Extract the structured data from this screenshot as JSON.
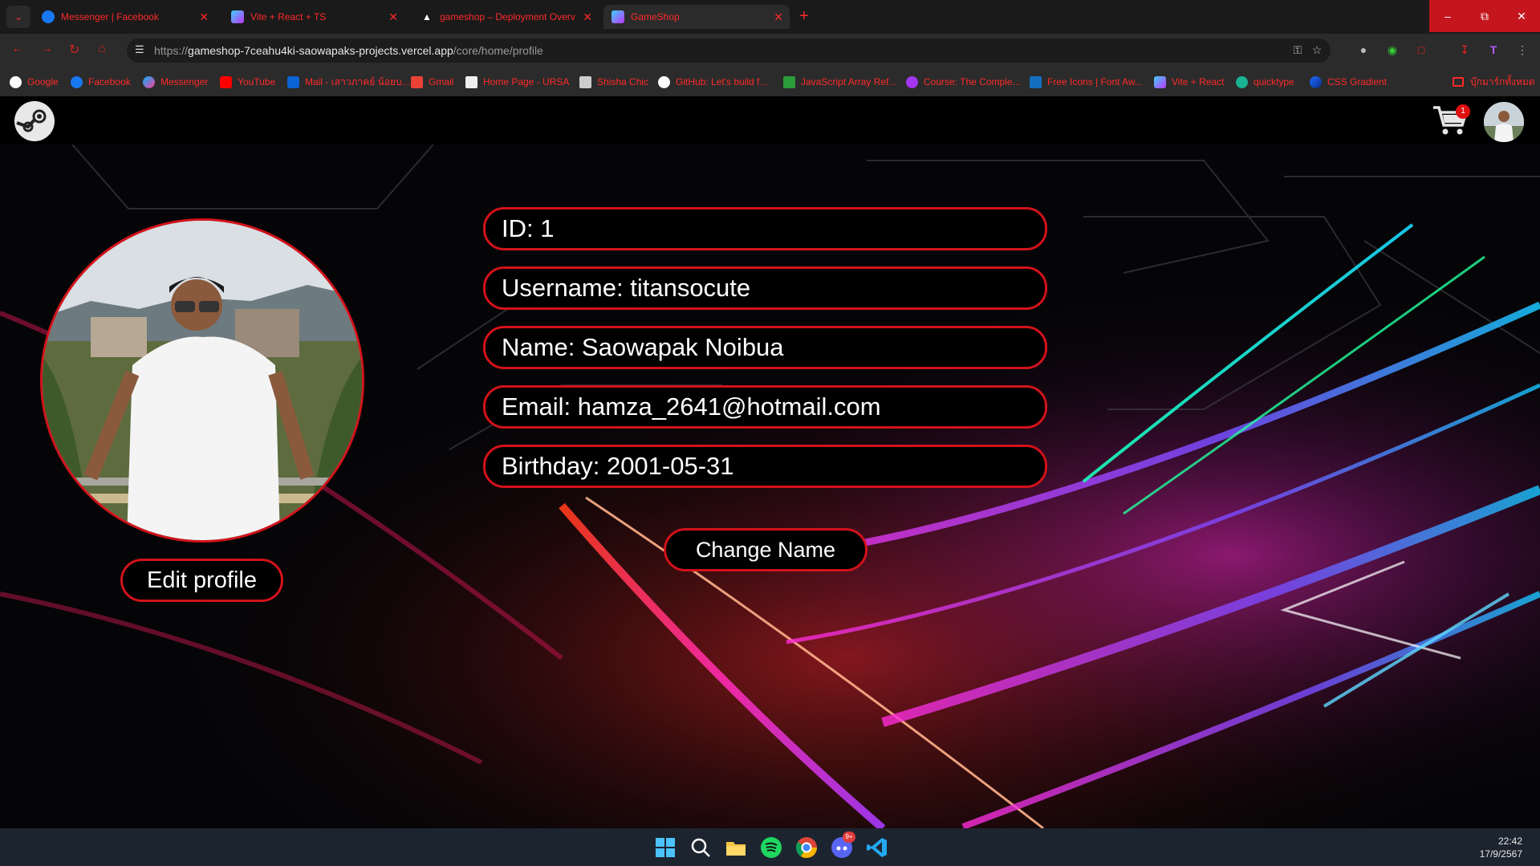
{
  "browser": {
    "tabs": [
      {
        "title": "Messenger | Facebook",
        "active": false
      },
      {
        "title": "Vite + React + TS",
        "active": false
      },
      {
        "title": "gameshop – Deployment Overv",
        "active": false
      },
      {
        "title": "GameShop",
        "active": true
      }
    ],
    "url": {
      "scheme": "https://",
      "host": "gameshop-7ceahu4ki-saowapaks-projects.vercel.app",
      "path": "/core/home/profile"
    },
    "bookmarks": [
      "Google",
      "Facebook",
      "Messenger",
      "YouTube",
      "Mail - เสาวภาคย์ น้อยบ...",
      "Gmail",
      "Home Page - URSA",
      "Shisha Chic",
      "GitHub: Let's build f...",
      "JavaScript Array Ref...",
      "Course: The Comple...",
      "Free Icons | Font Aw...",
      "Vite + React",
      "quicktype",
      "CSS Gradient"
    ],
    "all_bookmarks": "บุ๊กมาร์กทั้งหมด",
    "extension_badge": "T"
  },
  "navbar": {
    "cart_count": "1"
  },
  "profile": {
    "fields": [
      {
        "label": "ID: 1"
      },
      {
        "label": "Username: titansocute"
      },
      {
        "label": "Name: Saowapak Noibua"
      },
      {
        "label": "Email: hamza_2641@hotmail.com"
      },
      {
        "label": "Birthday: 2001-05-31"
      }
    ],
    "edit_button": "Edit profile",
    "change_name_button": "Change Name"
  },
  "taskbar": {
    "time": "22:42",
    "date": "17/9/2567",
    "discord_badge": "9+"
  },
  "colors": {
    "accent_red": "#d2121a",
    "browser_red_text": "#ff2a2a"
  }
}
